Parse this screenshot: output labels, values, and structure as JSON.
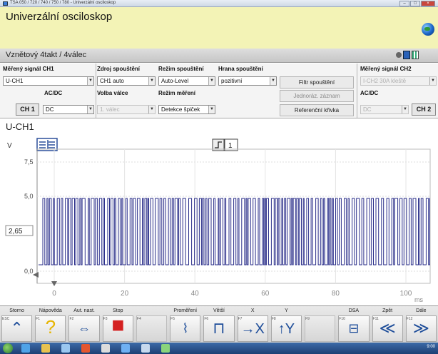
{
  "window": {
    "title": "TSA 050 / 720 / 740 / 750 / 780 - Univerzální osciloskop",
    "buttons": [
      "–",
      "□",
      "×"
    ]
  },
  "header": {
    "title": "Univerzální osciloskop",
    "globe_icon": "globe-icon"
  },
  "subheader": {
    "text": "Vznětový 4takt /  4válec"
  },
  "controls": {
    "ch1_label": "Měřený signál CH1",
    "ch1_value": "U-CH1",
    "acdc_label": "AC/DC",
    "acdc_value": "DC",
    "ch1_button": "CH 1",
    "trigger_source_label": "Zdroj spouštění",
    "trigger_source_value": "CH1 auto",
    "cylinder_label": "Volba válce",
    "cylinder_value": "1. válec",
    "trigger_mode_label": "Režim spouštění",
    "trigger_mode_value": "Auto-Level",
    "measure_mode_label": "Režim měření",
    "measure_mode_value": "Detekce špiček",
    "trigger_edge_label": "Hrana spouštění",
    "trigger_edge_value": "pozitivní",
    "trigger_filter_button": "Filtr spouštění",
    "single_record_button": "Jednoráz. záznam",
    "reference_curve_button": "Referenční křivka",
    "ch2_label": "Měřený signál CH2",
    "ch2_value": "I-CH2 30A kleště",
    "ch2_acdc_label": "AC/DC",
    "ch2_acdc_value": "DC",
    "ch2_button": "CH 2"
  },
  "scope": {
    "channel_title": "U-CH1",
    "y_unit": "V",
    "y_ticks": [
      "7,5",
      "5,0",
      "0,0"
    ],
    "trigger_level": "2,65",
    "x_ticks": [
      "0",
      "20",
      "40",
      "60",
      "80",
      "100"
    ],
    "x_unit": "ms",
    "trigger_indicator": "1",
    "trace_color": "#2b2f8a"
  },
  "fkeys": [
    {
      "caption": "Storno",
      "key": "ESC",
      "glyph": "⌃",
      "name": "cancel"
    },
    {
      "caption": "Nápověda",
      "key": "F1",
      "glyph": "?",
      "name": "help"
    },
    {
      "caption": "Aut. nast.",
      "key": "F2",
      "glyph": "⇔",
      "name": "auto-setup"
    },
    {
      "caption": "Stop",
      "key": "F3",
      "glyph": "■",
      "name": "stop"
    },
    {
      "caption": "",
      "key": "F4",
      "glyph": "",
      "name": "empty-f4"
    },
    {
      "caption": "Proměření",
      "key": "F5",
      "glyph": "⌇",
      "name": "measure"
    },
    {
      "caption": "Větší",
      "key": "F6",
      "glyph": "⊓",
      "name": "bigger"
    },
    {
      "caption": "X",
      "key": "F7",
      "glyph": "→X",
      "name": "x-axis"
    },
    {
      "caption": "Y",
      "key": "F8",
      "glyph": "↑Y",
      "name": "y-axis"
    },
    {
      "caption": "",
      "key": "F9",
      "glyph": "",
      "name": "empty-f9"
    },
    {
      "caption": "DSA",
      "key": "F10",
      "glyph": "⊟",
      "name": "dsa"
    },
    {
      "caption": "Zpět",
      "key": "F11",
      "glyph": "≪",
      "name": "back"
    },
    {
      "caption": "Dále",
      "key": "F12",
      "glyph": "≫",
      "name": "next"
    }
  ],
  "taskbar": {
    "clock": "9:00"
  }
}
